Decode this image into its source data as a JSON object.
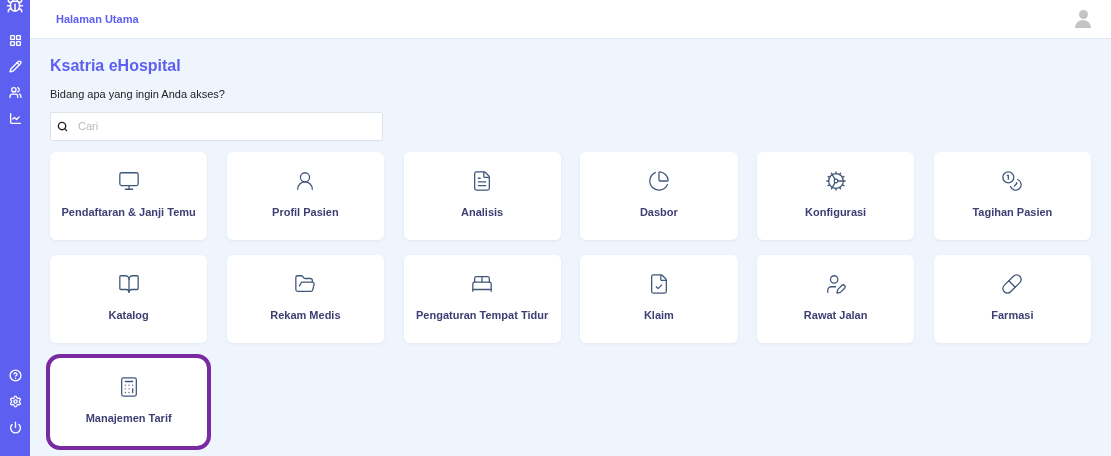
{
  "header": {
    "breadcrumb": "Halaman Utama"
  },
  "title": "Ksatria eHospital",
  "subtitle": "Bidang apa yang ingin Anda akses?",
  "search": {
    "placeholder": "Cari"
  },
  "modules": [
    {
      "label": "Pendaftaran & Janji Temu",
      "highlighted": false
    },
    {
      "label": "Profil Pasien",
      "highlighted": false
    },
    {
      "label": "Analisis",
      "highlighted": false
    },
    {
      "label": "Dasbor",
      "highlighted": false
    },
    {
      "label": "Konfigurasi",
      "highlighted": false
    },
    {
      "label": "Tagihan Pasien",
      "highlighted": false
    },
    {
      "label": "Katalog",
      "highlighted": false
    },
    {
      "label": "Rekam Medis",
      "highlighted": false
    },
    {
      "label": "Pengaturan Tempat Tidur",
      "highlighted": false
    },
    {
      "label": "Klaim",
      "highlighted": false
    },
    {
      "label": "Rawat Jalan",
      "highlighted": false
    },
    {
      "label": "Farmasi",
      "highlighted": false
    },
    {
      "label": "Manajemen Tarif",
      "highlighted": true
    }
  ]
}
